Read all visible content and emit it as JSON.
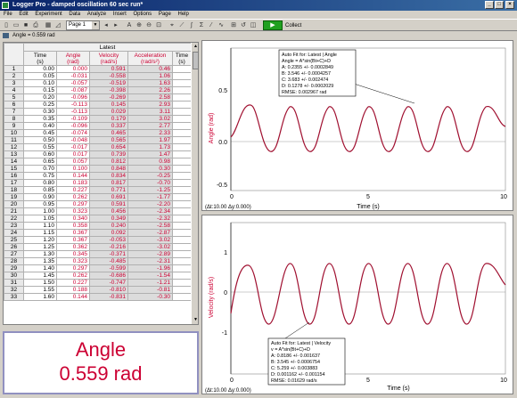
{
  "window": {
    "title": "Logger Pro - damped oscillation 60 sec run*"
  },
  "menu": [
    "File",
    "Edit",
    "Experiment",
    "Data",
    "Analyze",
    "Insert",
    "Options",
    "Page",
    "Help"
  ],
  "toolbar": {
    "page_select": "Page 1",
    "collect_label": "Collect"
  },
  "status": {
    "readout": "Angle = 0.559 rad"
  },
  "table": {
    "group_header": "Latest",
    "columns": [
      {
        "name": "Time",
        "unit": "(s)"
      },
      {
        "name": "Angle",
        "unit": "(rad)"
      },
      {
        "name": "Velocity",
        "unit": "(rad/s)"
      },
      {
        "name": "Acceleration",
        "unit": "(rad/s²)"
      },
      {
        "name": "Time",
        "unit": "(s)"
      }
    ],
    "rows": [
      [
        "1",
        "0.00",
        "0.000",
        "0.591",
        "0.46"
      ],
      [
        "2",
        "0.05",
        "-0.031",
        "-0.558",
        "1.06"
      ],
      [
        "3",
        "0.10",
        "-0.057",
        "-0.519",
        "1.63"
      ],
      [
        "4",
        "0.15",
        "-0.087",
        "-0.398",
        "2.26"
      ],
      [
        "5",
        "0.20",
        "-0.096",
        "-0.269",
        "2.58"
      ],
      [
        "6",
        "0.25",
        "-0.113",
        "0.145",
        "2.93"
      ],
      [
        "7",
        "0.30",
        "-0.113",
        "0.029",
        "3.11"
      ],
      [
        "8",
        "0.35",
        "-0.109",
        "0.179",
        "3.02"
      ],
      [
        "9",
        "0.40",
        "-0.096",
        "0.337",
        "2.77"
      ],
      [
        "10",
        "0.45",
        "-0.074",
        "0.465",
        "2.33"
      ],
      [
        "11",
        "0.50",
        "-0.048",
        "0.565",
        "1.97"
      ],
      [
        "12",
        "0.55",
        "-0.017",
        "0.654",
        "1.73"
      ],
      [
        "13",
        "0.60",
        "0.017",
        "0.739",
        "1.47"
      ],
      [
        "14",
        "0.65",
        "0.057",
        "0.812",
        "0.98"
      ],
      [
        "15",
        "0.70",
        "0.100",
        "0.848",
        "0.30"
      ],
      [
        "16",
        "0.75",
        "0.144",
        "0.834",
        "-0.25"
      ],
      [
        "17",
        "0.80",
        "0.183",
        "0.817",
        "-0.70"
      ],
      [
        "18",
        "0.85",
        "0.227",
        "0.771",
        "-1.25"
      ],
      [
        "19",
        "0.90",
        "0.262",
        "0.691",
        "-1.77"
      ],
      [
        "20",
        "0.95",
        "0.297",
        "0.591",
        "-2.20"
      ],
      [
        "21",
        "1.00",
        "0.323",
        "0.456",
        "-2.34"
      ],
      [
        "22",
        "1.05",
        "0.340",
        "0.349",
        "-2.32"
      ],
      [
        "23",
        "1.10",
        "0.358",
        "0.240",
        "-2.58"
      ],
      [
        "24",
        "1.15",
        "0.367",
        "0.092",
        "-2.87"
      ],
      [
        "25",
        "1.20",
        "0.367",
        "-0.053",
        "-3.02"
      ],
      [
        "26",
        "1.25",
        "0.362",
        "-0.216",
        "-3.02"
      ],
      [
        "27",
        "1.30",
        "0.345",
        "-0.371",
        "-2.89"
      ],
      [
        "28",
        "1.35",
        "0.323",
        "-0.485",
        "-2.31"
      ],
      [
        "29",
        "1.40",
        "0.297",
        "-0.599",
        "-1.96"
      ],
      [
        "30",
        "1.45",
        "0.262",
        "-0.686",
        "-1.54"
      ],
      [
        "31",
        "1.50",
        "0.227",
        "-0.747",
        "-1.21"
      ],
      [
        "32",
        "1.55",
        "0.188",
        "-0.810",
        "-0.81"
      ],
      [
        "33",
        "1.60",
        "0.144",
        "-0.831",
        "-0.30"
      ]
    ]
  },
  "meter": {
    "label": "Angle",
    "value": "0.559 rad"
  },
  "graph_top": {
    "ylabel": "Angle (rad)",
    "xlabel": "Time (s)",
    "status": "(Δt:10.00 Δy:0.000)",
    "fit_box": [
      "Auto Fit for: Latest | Angle",
      "Angle = A*sin(Bt+C)+D",
      "A: 0.2355 +/- 0.0002849",
      "B: 3.546 +/- 0.0004257",
      "C: 3.683 +/- 0.002474",
      "D: 0.1278 +/- 0.0002029",
      "RMSE: 0.002967 rad"
    ],
    "yticks": [
      "0.5",
      "0.0",
      "-0.5"
    ],
    "xticks": [
      "0",
      "5",
      "10"
    ]
  },
  "graph_bottom": {
    "ylabel": "Velocity (rad/s)",
    "xlabel": "Time (s)",
    "status": "(Δt:10.00 Δy:0.000)",
    "fit_box": [
      "Auto Fit for: Latest | Velocity",
      "v = A*sin(Bt+C)+D",
      "A: 0.8186 +/- 0.001637",
      "B: 3.545 +/- 0.0006754",
      "C: 5.259 +/- 0.003883",
      "D: 0.001162 +/- 0.001154",
      "RMSE: 0.01629 rad/s"
    ],
    "yticks": [
      "1",
      "0",
      "-1"
    ],
    "xticks": [
      "0",
      "5",
      "10"
    ]
  },
  "colors": {
    "curve": "#a01030",
    "fit_text": "#000000",
    "accent": "#cc0033"
  },
  "icons": [
    "new-icon",
    "open-icon",
    "save-icon",
    "print-icon",
    "table-icon",
    "graph-icon",
    "text-icon",
    "zoom-in-icon",
    "zoom-out-icon",
    "examine-icon",
    "tangent-icon",
    "integral-icon",
    "stats-icon",
    "curvefit-icon",
    "linear-fit-icon",
    "play-icon"
  ]
}
